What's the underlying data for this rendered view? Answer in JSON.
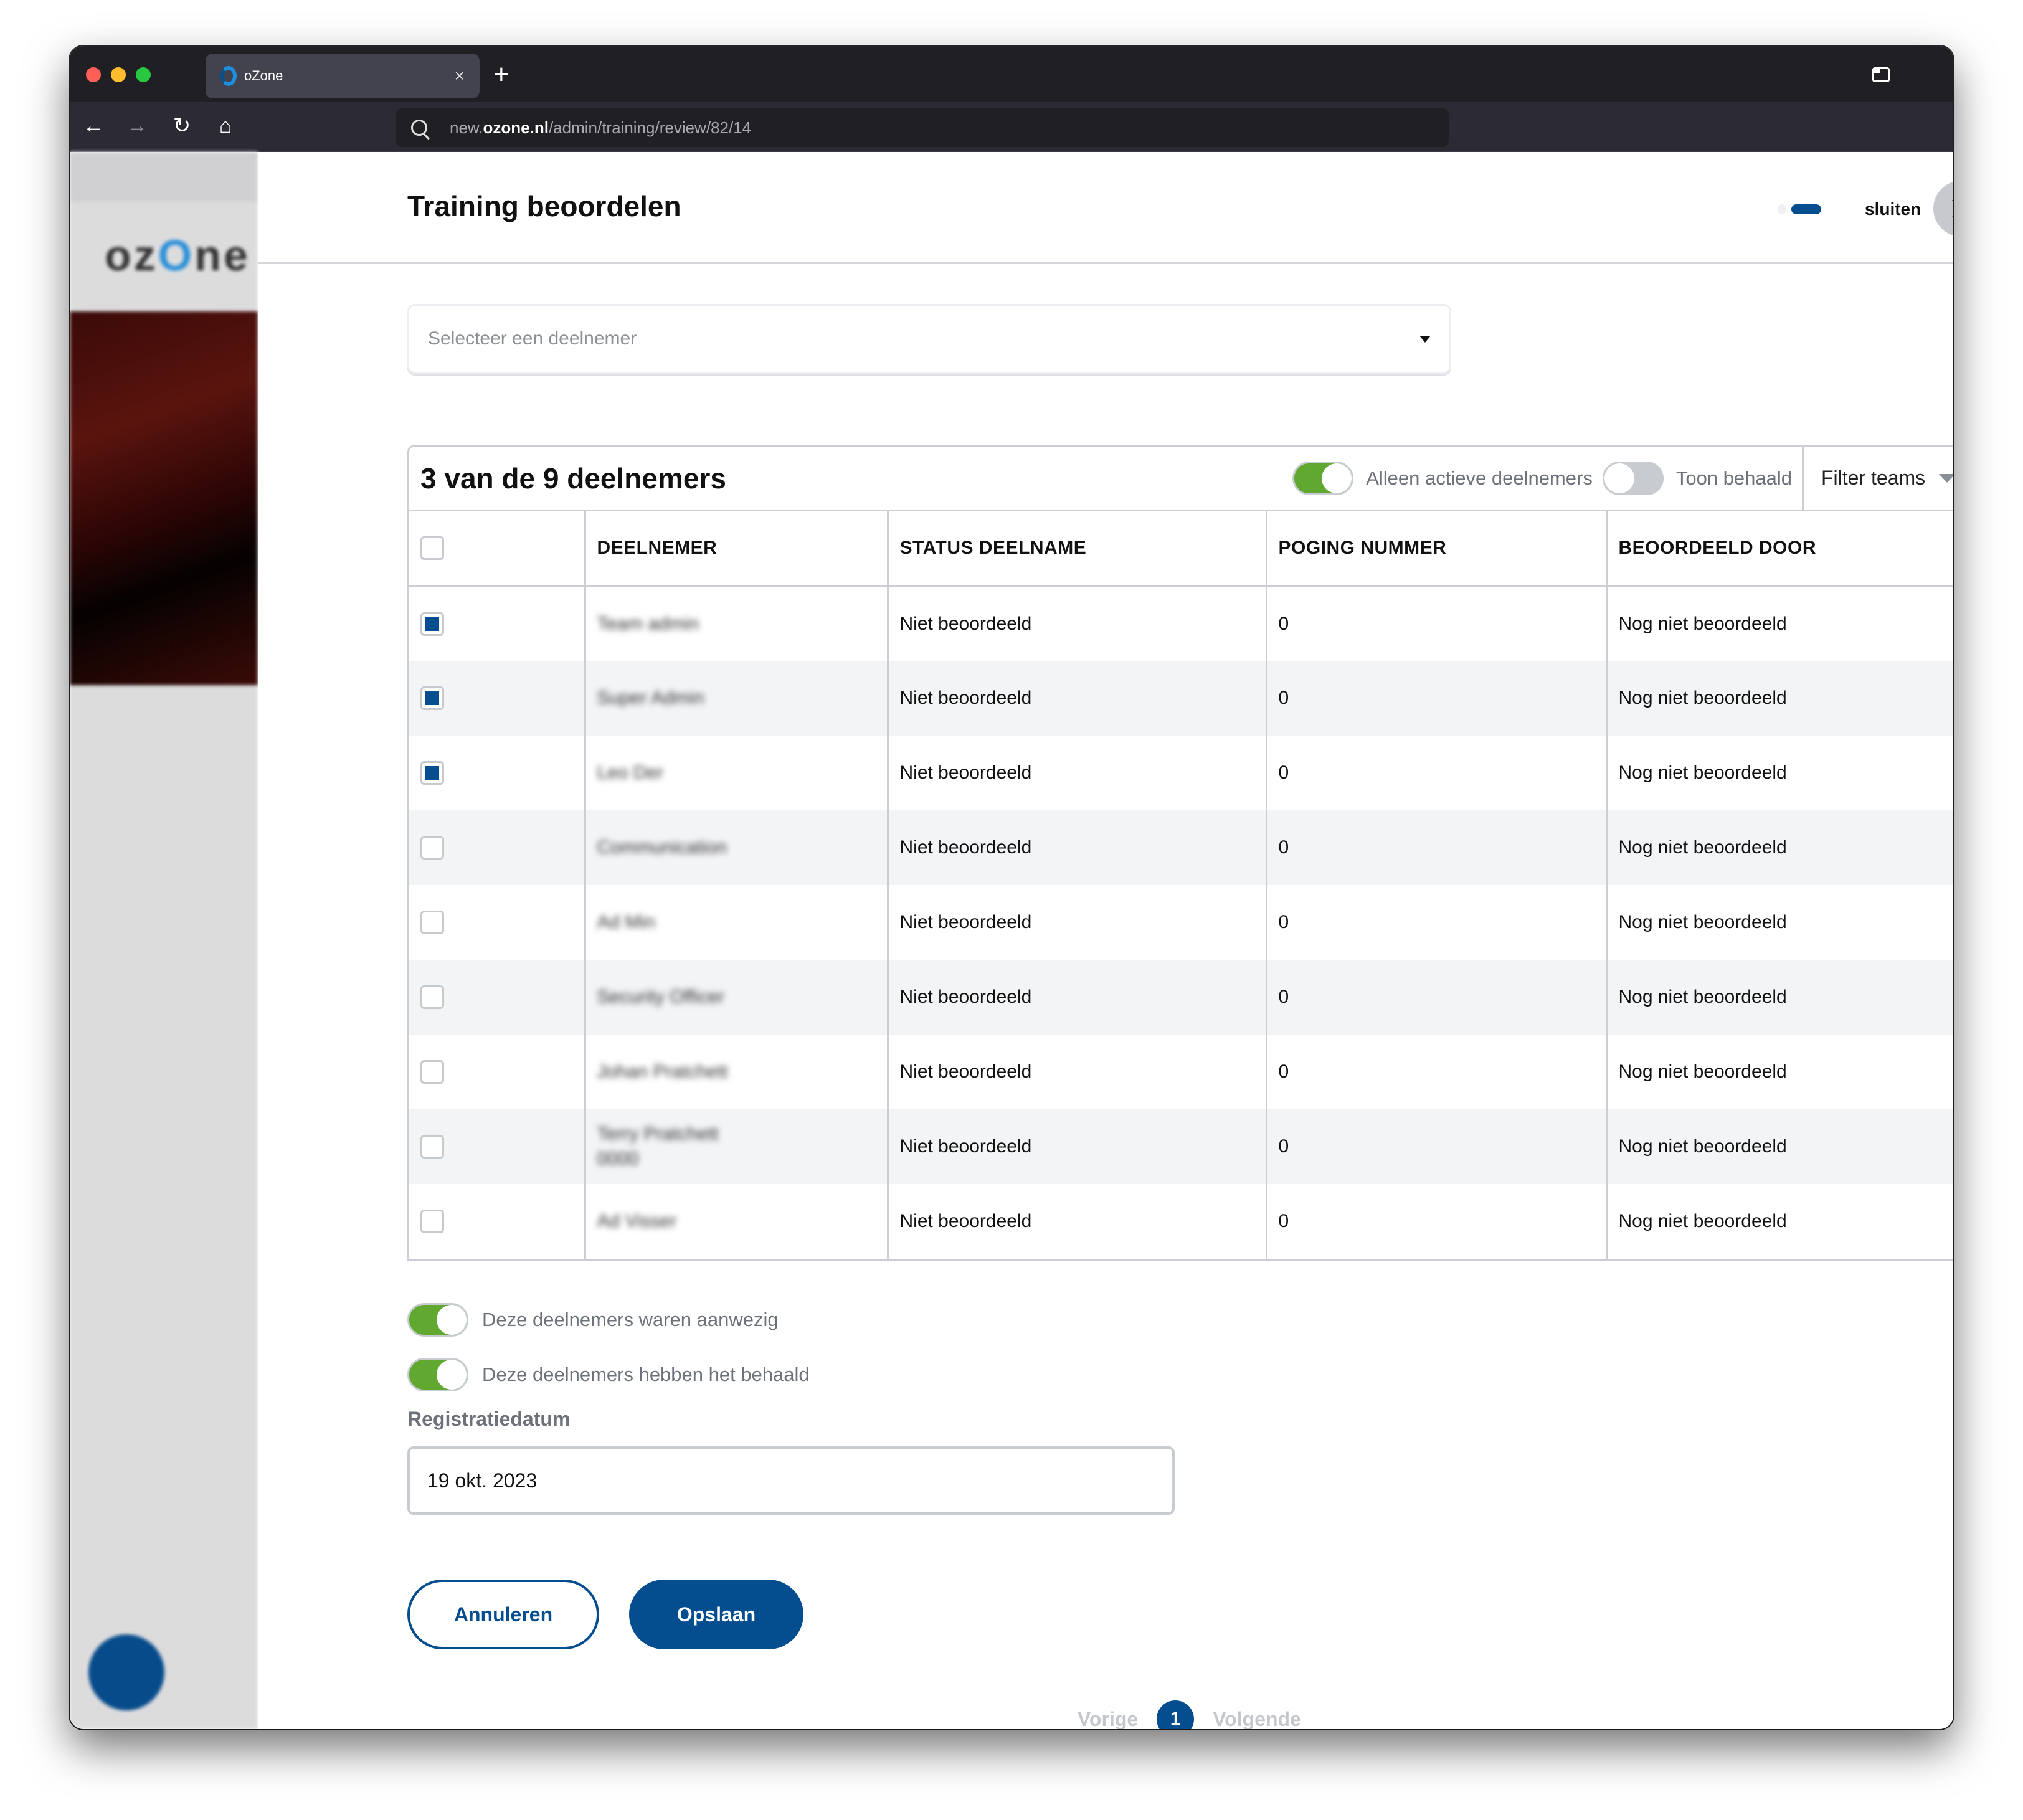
{
  "browser": {
    "tab_title": "oZone",
    "tab_close": "×",
    "new_tab": "+",
    "url_prefix": "new.",
    "url_host": "ozone.nl",
    "url_path": "/admin/training/review/82/14",
    "nav": {
      "back": "←",
      "forward": "→",
      "reload": "↻",
      "home": "⌂"
    }
  },
  "sidebar": {
    "logo_pre": "oz",
    "logo_o": "O",
    "logo_post": "ne"
  },
  "modal": {
    "title": "Training beoordelen",
    "close_label": "sluiten",
    "step_current": 2,
    "step_total": 2
  },
  "participant_select": {
    "placeholder": "Selecteer een deelnemer",
    "value": ""
  },
  "table": {
    "count_label": "3 van de 9 deelnemers",
    "filters": {
      "active_only": {
        "label": "Alleen actieve deelnemers",
        "on": true
      },
      "show_passed": {
        "label": "Toon behaald",
        "on": false
      },
      "filter_teams": "Filter teams"
    },
    "columns": [
      "DEELNEMER",
      "STATUS DEELNAME",
      "POGING NUMMER",
      "BEOORDEELD DOOR"
    ],
    "select_all_checked": false,
    "rows": [
      {
        "checked": true,
        "name": "Team admin",
        "status": "Niet beoordeeld",
        "attempt": "0",
        "reviewed_by": "Nog niet beoordeeld"
      },
      {
        "checked": true,
        "name": "Super Admin",
        "status": "Niet beoordeeld",
        "attempt": "0",
        "reviewed_by": "Nog niet beoordeeld"
      },
      {
        "checked": true,
        "name": "Leo Der",
        "status": "Niet beoordeeld",
        "attempt": "0",
        "reviewed_by": "Nog niet beoordeeld"
      },
      {
        "checked": false,
        "name": "Communication",
        "status": "Niet beoordeeld",
        "attempt": "0",
        "reviewed_by": "Nog niet beoordeeld"
      },
      {
        "checked": false,
        "name": "Ad Min",
        "status": "Niet beoordeeld",
        "attempt": "0",
        "reviewed_by": "Nog niet beoordeeld"
      },
      {
        "checked": false,
        "name": "Security Officer",
        "status": "Niet beoordeeld",
        "attempt": "0",
        "reviewed_by": "Nog niet beoordeeld"
      },
      {
        "checked": false,
        "name": "Johan Pratchett",
        "status": "Niet beoordeeld",
        "attempt": "0",
        "reviewed_by": "Nog niet beoordeeld"
      },
      {
        "checked": false,
        "name": "Terry Pratchett 0000",
        "status": "Niet beoordeeld",
        "attempt": "0",
        "reviewed_by": "Nog niet beoordeeld"
      },
      {
        "checked": false,
        "name": "Ad Visser",
        "status": "Niet beoordeeld",
        "attempt": "0",
        "reviewed_by": "Nog niet beoordeeld"
      }
    ]
  },
  "form": {
    "present_toggle": {
      "label": "Deze deelnemers waren aanwezig",
      "on": true
    },
    "passed_toggle": {
      "label": "Deze deelnemers hebben het behaald",
      "on": true
    },
    "registration_date_label": "Registratiedatum",
    "registration_date_value": "19 okt. 2023"
  },
  "actions": {
    "cancel": "Annuleren",
    "save": "Opslaan"
  },
  "pagination": {
    "prev": "Vorige",
    "current": "1",
    "next": "Volgende"
  },
  "colors": {
    "brand_blue": "#044e8f",
    "toggle_green": "#60a830",
    "border_gray": "#ccced3"
  }
}
